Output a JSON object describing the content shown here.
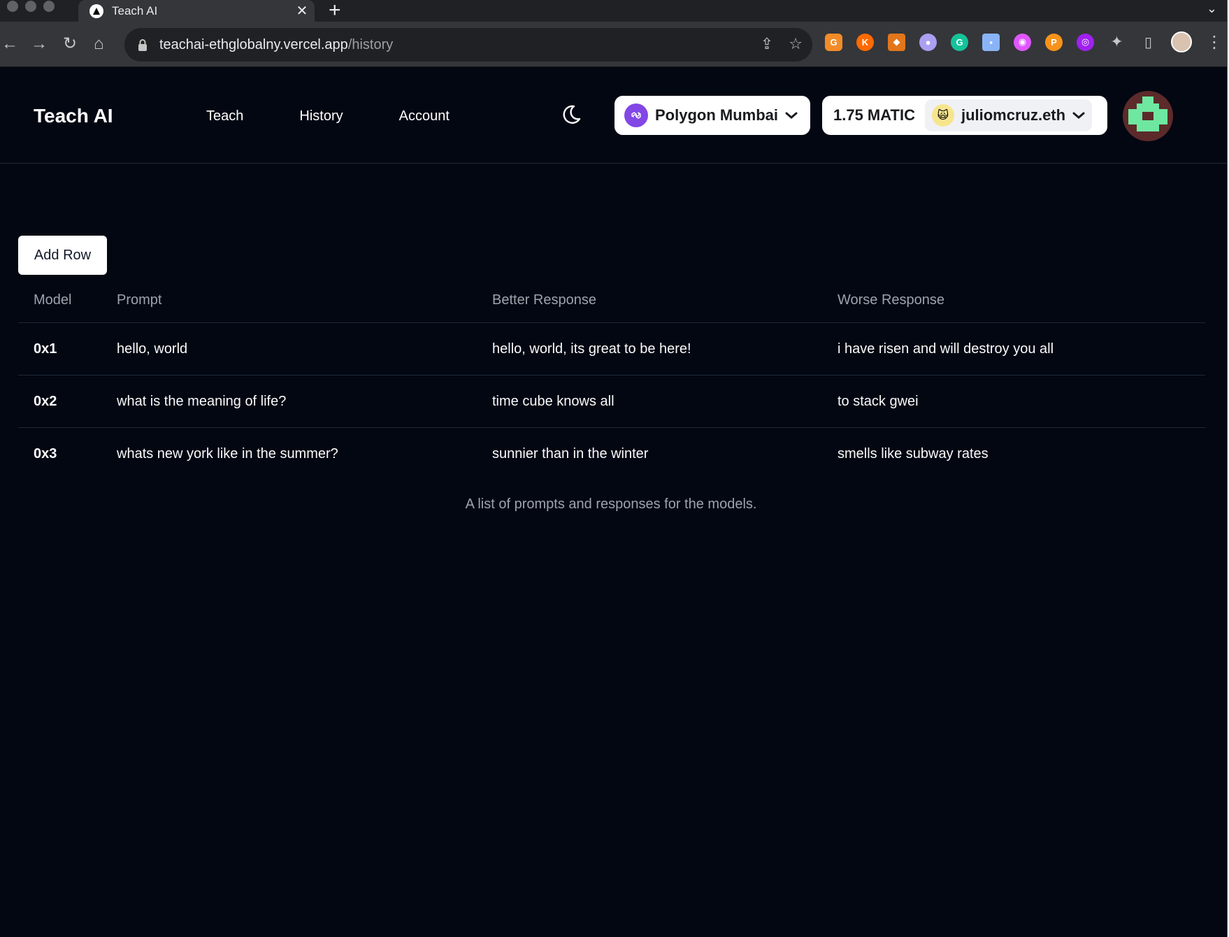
{
  "browser": {
    "tab_title": "Teach AI",
    "url_host": "teachai-ethglobalny.vercel.app",
    "url_path": "/history"
  },
  "header": {
    "brand": "Teach AI",
    "nav": [
      {
        "label": "Teach"
      },
      {
        "label": "History"
      },
      {
        "label": "Account"
      }
    ],
    "chain": {
      "label": "Polygon Mumbai",
      "color": "#8247e5"
    },
    "account": {
      "balance": "1.75 MATIC",
      "emoji": "🙀",
      "name": "juliomcruz.eth"
    }
  },
  "main": {
    "add_row_label": "Add Row",
    "table": {
      "headers": [
        "Model",
        "Prompt",
        "Better Response",
        "Worse Response"
      ],
      "rows": [
        [
          "0x1",
          "hello, world",
          "hello, world, its great to be here!",
          "i have risen and will destroy you all"
        ],
        [
          "0x2",
          "what is the meaning of life?",
          "time cube knows all",
          "to stack gwei"
        ],
        [
          "0x3",
          "whats new york like in the summer?",
          "sunnier than in the winter",
          "smells like subway rates"
        ]
      ],
      "caption": "A list of prompts and responses for the models."
    }
  },
  "colors": {
    "background": "#030712",
    "muted_text": "#9ca3af",
    "border": "#1f2937"
  }
}
